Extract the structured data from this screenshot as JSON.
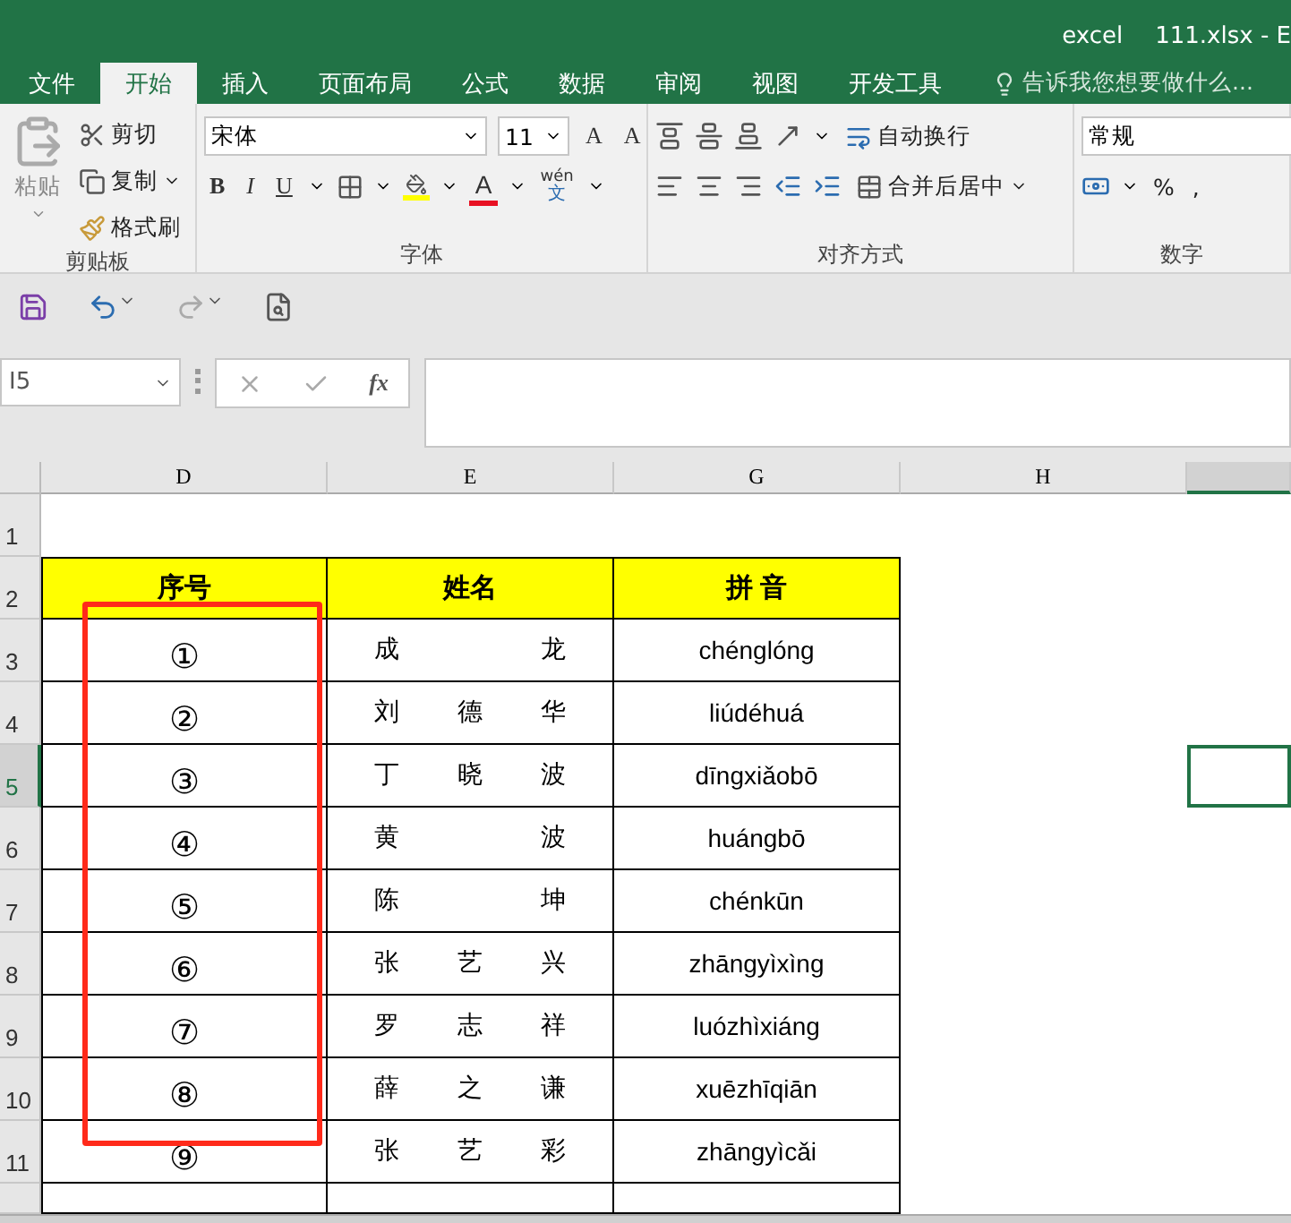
{
  "window": {
    "app": "excel",
    "title": "111.xlsx - E"
  },
  "tabs": [
    {
      "label": "文件",
      "selected": false
    },
    {
      "label": "开始",
      "selected": true
    },
    {
      "label": "插入",
      "selected": false
    },
    {
      "label": "页面布局",
      "selected": false
    },
    {
      "label": "公式",
      "selected": false
    },
    {
      "label": "数据",
      "selected": false
    },
    {
      "label": "审阅",
      "selected": false
    },
    {
      "label": "视图",
      "selected": false
    },
    {
      "label": "开发工具",
      "selected": false
    }
  ],
  "tell_me": {
    "placeholder": "告诉我您想要做什么..."
  },
  "ribbon": {
    "clipboard": {
      "paste": "粘贴",
      "cut": "剪切",
      "copy": "复制",
      "format_painter": "格式刷",
      "label": "剪贴板"
    },
    "font": {
      "font_name": "宋体",
      "font_size": "11",
      "grow": "A",
      "shrink": "A",
      "bold": "B",
      "italic": "I",
      "underline": "U",
      "font_color": "A",
      "phonetic_top": "wén",
      "phonetic_char": "文",
      "label": "字体"
    },
    "alignment": {
      "wrap_text": "自动换行",
      "merge_center": "合并后居中",
      "label": "对齐方式"
    },
    "number": {
      "format": "常规",
      "percent": "%",
      "comma": ",",
      "label": "数字"
    }
  },
  "formula_bar": {
    "name_box": "I5",
    "fx": "fx"
  },
  "columns": [
    {
      "label": "D",
      "selected": false
    },
    {
      "label": "E",
      "selected": false
    },
    {
      "label": "G",
      "selected": false
    },
    {
      "label": "H",
      "selected": false
    },
    {
      "selected": true
    }
  ],
  "sheet": {
    "row_1": "1",
    "header": {
      "row": "2",
      "cells": [
        "序号",
        "姓名",
        "拼 音"
      ]
    },
    "rows": [
      {
        "row": "3",
        "number": "①",
        "name": [
          "成",
          "龙"
        ],
        "pinyin": "chénglóng",
        "selected": false
      },
      {
        "row": "4",
        "number": "②",
        "name": [
          "刘",
          "德",
          "华"
        ],
        "pinyin": "liúdéhuá",
        "selected": false
      },
      {
        "row": "5",
        "number": "③",
        "name": [
          "丁",
          "晓",
          "波"
        ],
        "pinyin": "dīngxiǎobō",
        "selected": true
      },
      {
        "row": "6",
        "number": "④",
        "name": [
          "黄",
          "波"
        ],
        "pinyin": "huángbō",
        "selected": false
      },
      {
        "row": "7",
        "number": "⑤",
        "name": [
          "陈",
          "坤"
        ],
        "pinyin": "chénkūn",
        "selected": false
      },
      {
        "row": "8",
        "number": "⑥",
        "name": [
          "张",
          "艺",
          "兴"
        ],
        "pinyin": "zhāngyìxìng",
        "selected": false
      },
      {
        "row": "9",
        "number": "⑦",
        "name": [
          "罗",
          "志",
          "祥"
        ],
        "pinyin": "luózhìxiáng",
        "selected": false
      },
      {
        "row": "10",
        "number": "⑧",
        "name": [
          "薛",
          "之",
          "谦"
        ],
        "pinyin": "xuēzhīqiān",
        "selected": false
      },
      {
        "row": "11",
        "number": "⑨",
        "name": [
          "张",
          "艺",
          "彩"
        ],
        "pinyin": "zhāngyìcǎi",
        "selected": false
      }
    ]
  }
}
